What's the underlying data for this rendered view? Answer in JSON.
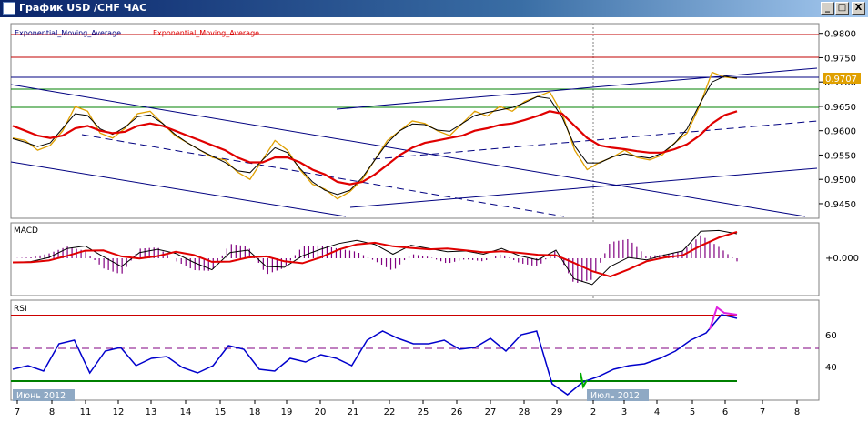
{
  "window": {
    "title": "График USD /CHF ЧАС"
  },
  "buttons": {
    "minimize": "_",
    "maximize": "□",
    "close": "X"
  },
  "main_panel": {
    "indicator_label_1": "Exponential_Moving_Average",
    "indicator_label_2": "Exponential_Moving_Average",
    "price_ticks": [
      "0.9800",
      "0.9750",
      "0.9700",
      "0.9650",
      "0.9600",
      "0.9550",
      "0.9500",
      "0.9450"
    ],
    "current_price": "0.9707"
  },
  "macd_panel": {
    "label": "MACD",
    "zero_tick": "+0.000"
  },
  "rsi_panel": {
    "label": "RSI",
    "ticks": [
      "60",
      "40"
    ]
  },
  "time_axis": {
    "labels": [
      "7",
      "8",
      "11",
      "12",
      "13",
      "14",
      "15",
      "18",
      "19",
      "20",
      "21",
      "22",
      "25",
      "26",
      "27",
      "28",
      "29",
      "2",
      "3",
      "4",
      "5",
      "6",
      "7",
      "8"
    ],
    "month_label_left": "Июнь 2012",
    "month_label_right": "Июль 2012"
  },
  "colors": {
    "price": "#e0a000",
    "ema_slow": "#e00000",
    "ema_fast": "#000000",
    "channel": "#000080",
    "macd_hist": "#800080",
    "rsi": "#0000cc",
    "rsi_upper": "#cc0000",
    "rsi_lower": "#008000",
    "current_price_bg": "#e0a000"
  },
  "chart_data": [
    {
      "type": "line",
      "title": "",
      "series": [
        {
          "values": [
            0.9585,
            0.958,
            0.956,
            0.957,
            0.96,
            0.965,
            0.964,
            0.9595,
            0.9585,
            0.9605,
            0.9635,
            0.964,
            0.9615,
            0.959,
            0.9575,
            0.956,
            0.9545,
            0.954,
            0.9515,
            0.95,
            0.954,
            0.958,
            0.956,
            0.952,
            0.949,
            0.948,
            0.946,
            0.9475,
            0.95,
            0.954,
            0.958,
            0.96,
            0.962,
            0.9615,
            0.96,
            0.959,
            0.9615,
            0.964,
            0.963,
            0.965,
            0.964,
            0.966,
            0.967,
            0.968,
            0.9635,
            0.956,
            0.952,
            0.9535,
            0.9545,
            0.956,
            0.9545,
            0.954,
            0.955,
            0.9575,
            0.9595,
            0.965,
            0.972,
            0.971,
            0.9707
          ]
        },
        {
          "name": "Exponential_Moving_Average",
          "values": [
            0.961,
            0.96,
            0.959,
            0.9585,
            0.959,
            0.9605,
            0.961,
            0.96,
            0.9595,
            0.9598,
            0.961,
            0.9615,
            0.961,
            0.96,
            0.959,
            0.958,
            0.957,
            0.956,
            0.9545,
            0.9535,
            0.9535,
            0.9545,
            0.9545,
            0.9535,
            0.952,
            0.951,
            0.9495,
            0.949,
            0.9495,
            0.951,
            0.953,
            0.955,
            0.9565,
            0.9575,
            0.958,
            0.9585,
            0.959,
            0.96,
            0.9605,
            0.9612,
            0.9615,
            0.9622,
            0.963,
            0.964,
            0.9635,
            0.961,
            0.9585,
            0.957,
            0.9565,
            0.9562,
            0.9558,
            0.9555,
            0.9555,
            0.9562,
            0.9572,
            0.959,
            0.9615,
            0.9632,
            0.964
          ]
        }
      ],
      "ylim": [
        0.942,
        0.982
      ]
    },
    {
      "type": "line",
      "title": "",
      "series": [
        {
          "name": "MACD",
          "values": [
            -0.0005,
            -0.0004,
            0.0001,
            0.0012,
            0.0015,
            0.0002,
            -0.001,
            0.0007,
            0.0011,
            0.0006,
            -0.0005,
            -0.0014,
            0.0007,
            0.001,
            -0.001,
            -0.0011,
            0.0003,
            0.0011,
            0.0018,
            0.0022,
            0.0017,
            0.0005,
            0.0016,
            0.0012,
            0.0008,
            0.0009,
            0.0005,
            0.0012,
            0.0003,
            -0.0002,
            0.001,
            -0.0025,
            -0.0032,
            -0.001,
            0.0001,
            -0.0002,
            0.0004,
            0.0009,
            0.0033,
            0.0034,
            0.003
          ]
        }
      ]
    },
    {
      "type": "line",
      "title": "",
      "series": [
        {
          "name": "RSI",
          "values": [
            42,
            44,
            41,
            56,
            58,
            40,
            52,
            54,
            44,
            48,
            49,
            43,
            40,
            44,
            55,
            53,
            42,
            41,
            48,
            46,
            50,
            48,
            44,
            58,
            63,
            59,
            56,
            56,
            58,
            53,
            54,
            59,
            52,
            61,
            63,
            34,
            28,
            35,
            38,
            42,
            44,
            45,
            48,
            52,
            58,
            62,
            72,
            70
          ]
        }
      ],
      "ylim": [
        25,
        80
      ]
    }
  ]
}
